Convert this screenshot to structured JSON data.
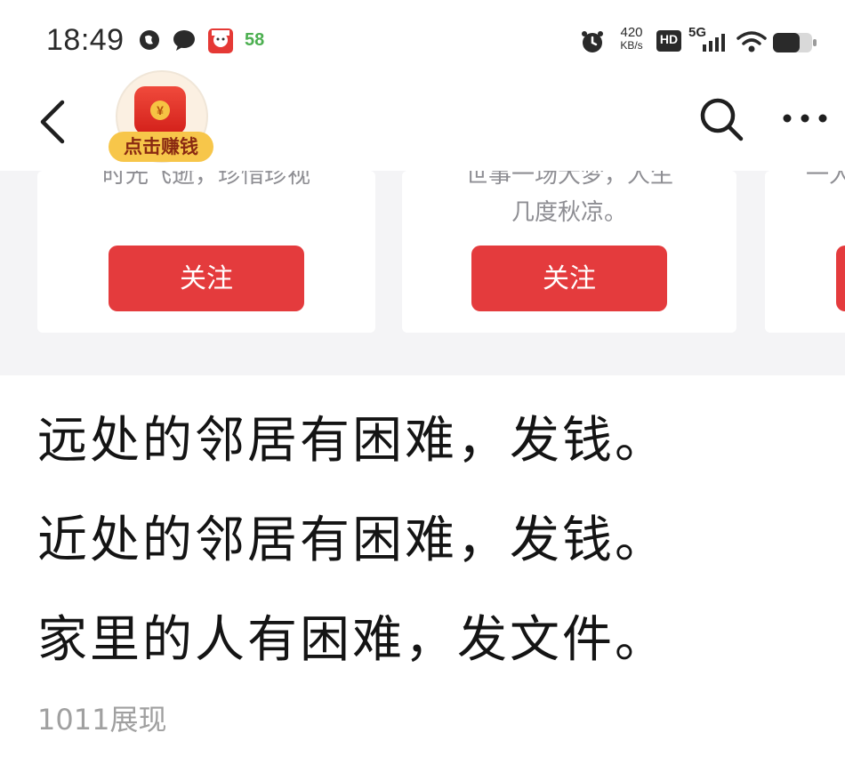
{
  "status_bar": {
    "time": "18:49",
    "notification_count": "58",
    "net_speed_value": "420",
    "net_speed_unit": "KB/s",
    "hd_label": "HD",
    "network_type": "5G"
  },
  "header": {
    "redpacket_label": "点击赚钱",
    "coin_symbol": "¥"
  },
  "recommend_cards": [
    {
      "desc_lines": [
        "时光飞逝，珍惜珍视"
      ],
      "follow_label": "关注"
    },
    {
      "desc_lines": [
        "世事一场大梦，人生",
        "几度秋凉。"
      ],
      "follow_label": "关注"
    },
    {
      "desc_lines": [
        "一人"
      ],
      "follow_label": ""
    }
  ],
  "post": {
    "lines": [
      "远处的邻居有困难，发钱。",
      "近处的邻居有困难，发钱。",
      "家里的人有困难，发文件。"
    ],
    "impressions": "1011展现"
  },
  "colors": {
    "follow_button": "#e43b3d",
    "redpacket_label_bg": "#f7c64a",
    "notification_green": "#4caf50",
    "text_primary": "#141414",
    "text_secondary": "#a0a0a0"
  }
}
